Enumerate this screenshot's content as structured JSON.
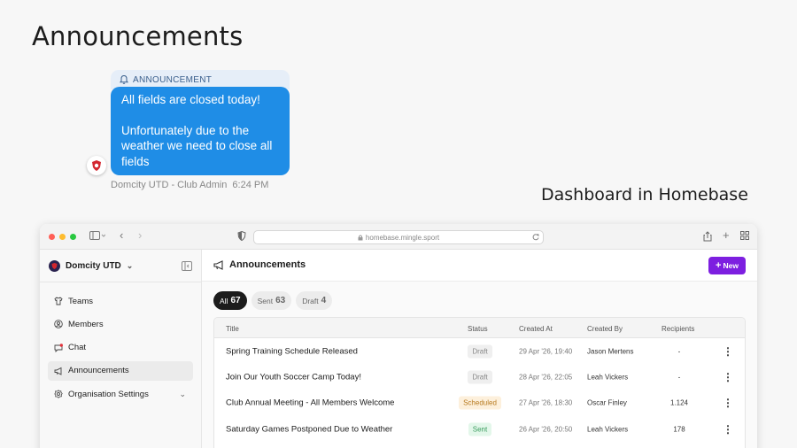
{
  "page": {
    "title": "Announcements",
    "caption": "Dashboard in Homebase"
  },
  "message": {
    "header_label": "ANNOUNCEMENT",
    "line1": "All fields are closed today!",
    "line2": "Unfortunately due to the weather we need to close all fields",
    "sender": "Domcity UTD - Club Admin",
    "time": "6:24 PM"
  },
  "browser": {
    "url": "homebase.mingle.sport"
  },
  "sidebar": {
    "club_name": "Domcity UTD",
    "items": [
      {
        "label": "Teams",
        "icon": "shirt-icon"
      },
      {
        "label": "Members",
        "icon": "user-circle-icon"
      },
      {
        "label": "Chat",
        "icon": "chat-icon"
      },
      {
        "label": "Announcements",
        "icon": "megaphone-icon",
        "active": true
      },
      {
        "label": "Organisation Settings",
        "icon": "gear-icon"
      }
    ]
  },
  "main": {
    "title": "Announcements",
    "new_button": "New",
    "tabs": [
      {
        "label": "All",
        "count": "67",
        "active": true
      },
      {
        "label": "Sent",
        "count": "63"
      },
      {
        "label": "Draft",
        "count": "4"
      }
    ],
    "columns": [
      "Title",
      "Status",
      "Created At",
      "Created By",
      "Recipients"
    ],
    "rows": [
      {
        "title": "Spring Training Schedule Released",
        "status": "Draft",
        "created_at": "29 Apr '26, 19:40",
        "created_by": "Jason Mertens",
        "recipients": "-"
      },
      {
        "title": "Join Our Youth Soccer Camp Today!",
        "status": "Draft",
        "created_at": "28 Apr '26, 22:05",
        "created_by": "Leah Vickers",
        "recipients": "-"
      },
      {
        "title": "Club Annual Meeting - All Members Welcome",
        "status": "Scheduled",
        "created_at": "27 Apr '26, 18:30",
        "created_by": "Oscar Finley",
        "recipients": "1.124"
      },
      {
        "title": "Saturday Games Postponed Due to Weather",
        "status": "Sent",
        "created_at": "26 Apr '26, 20:50",
        "created_by": "Leah Vickers",
        "recipients": "178"
      }
    ]
  },
  "colors": {
    "accent": "#7d1fe0",
    "bubble": "#1f8de6"
  }
}
